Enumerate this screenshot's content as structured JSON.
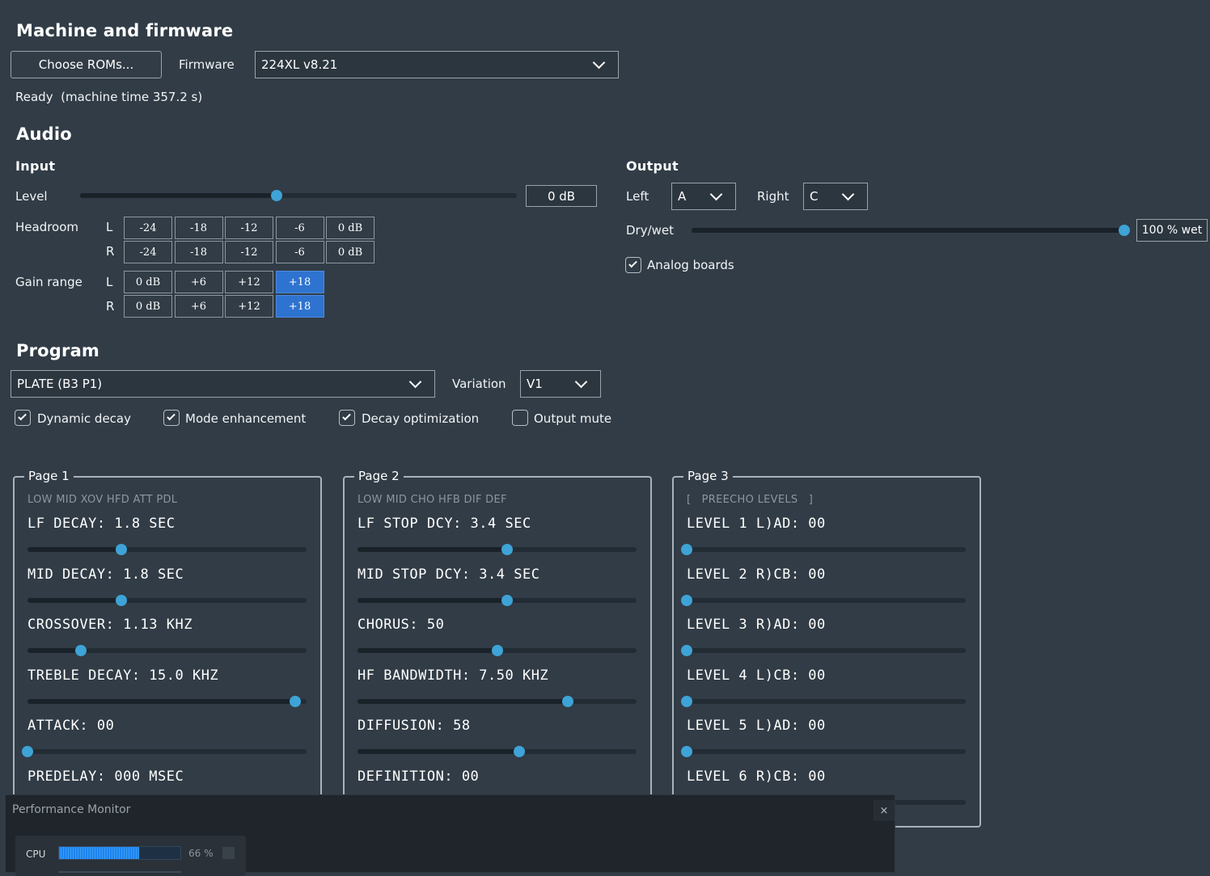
{
  "machine": {
    "heading": "Machine and firmware",
    "choose_roms": "Choose ROMs...",
    "firmware_label": "Firmware",
    "firmware_value": "224XL v8.21",
    "status": "Ready  (machine time 357.2 s)"
  },
  "audio": {
    "heading": "Audio",
    "input": {
      "heading": "Input",
      "level_label": "Level",
      "level_value": "0 dB",
      "level_position": 0.45,
      "headroom_label": "Headroom",
      "headroom_options": [
        "-24",
        "-18",
        "-12",
        "-6",
        "0 dB"
      ],
      "gain_label": "Gain range",
      "gain_options": [
        "0 dB",
        "+6",
        "+12",
        "+18"
      ],
      "gain_selected": "+18",
      "channel_l": "L",
      "channel_r": "R"
    },
    "output": {
      "heading": "Output",
      "left_label": "Left",
      "left_value": "A",
      "right_label": "Right",
      "right_value": "C",
      "drywet_label": "Dry/wet",
      "drywet_value": "100 % wet",
      "drywet_position": 1.0,
      "analog_label": "Analog boards",
      "analog_checked": true
    }
  },
  "program": {
    "heading": "Program",
    "program_value": "PLATE (B3 P1)",
    "variation_label": "Variation",
    "variation_value": "V1",
    "checks": [
      {
        "label": "Dynamic decay",
        "checked": true
      },
      {
        "label": "Mode enhancement",
        "checked": true
      },
      {
        "label": "Decay optimization",
        "checked": true
      },
      {
        "label": "Output mute",
        "checked": false
      }
    ]
  },
  "pages": [
    {
      "title": "Page 1",
      "header": "LOW MID XOV HFD ATT PDL",
      "params": [
        {
          "text": "LF DECAY: 1.8 SEC",
          "position": 0.335
        },
        {
          "text": "MID DECAY: 1.8 SEC",
          "position": 0.335
        },
        {
          "text": "CROSSOVER: 1.13 KHZ",
          "position": 0.19
        },
        {
          "text": "TREBLE DECAY: 15.0 KHZ",
          "position": 0.96
        },
        {
          "text": "ATTACK: 00",
          "position": 0.0
        },
        {
          "text": "PREDELAY: 000 MSEC",
          "position": 0.0
        }
      ]
    },
    {
      "title": "Page 2",
      "header": "LOW MID CHO HFB DIF DEF",
      "params": [
        {
          "text": "LF STOP DCY: 3.4 SEC",
          "position": 0.535
        },
        {
          "text": "MID STOP DCY: 3.4 SEC",
          "position": 0.535
        },
        {
          "text": "CHORUS: 50",
          "position": 0.5
        },
        {
          "text": "HF BANDWIDTH: 7.50 KHZ",
          "position": 0.755
        },
        {
          "text": "DIFFUSION: 58",
          "position": 0.58
        },
        {
          "text": "DEFINITION: 00",
          "position": 0.0
        }
      ]
    },
    {
      "title": "Page 3",
      "header": "[   PREECHO LEVELS   ]",
      "params": [
        {
          "text": "LEVEL 1 L)AD: 00",
          "position": 0.0
        },
        {
          "text": "LEVEL 2 R)CB: 00",
          "position": 0.0
        },
        {
          "text": "LEVEL 3 R)AD: 00",
          "position": 0.0
        },
        {
          "text": "LEVEL 4 L)CB: 00",
          "position": 0.0
        },
        {
          "text": "LEVEL 5 L)AD: 00",
          "position": 0.0
        },
        {
          "text": "LEVEL 6 R)CB: 00",
          "position": 0.0
        }
      ]
    }
  ],
  "performance": {
    "title": "Performance Monitor",
    "close": "×",
    "cpu_label": "CPU",
    "cpu_value": "66 %",
    "cpu_fraction": 0.66
  },
  "colors": {
    "background": "#313c46",
    "accent": "#3ea3d6",
    "selected": "#2e73cf"
  }
}
